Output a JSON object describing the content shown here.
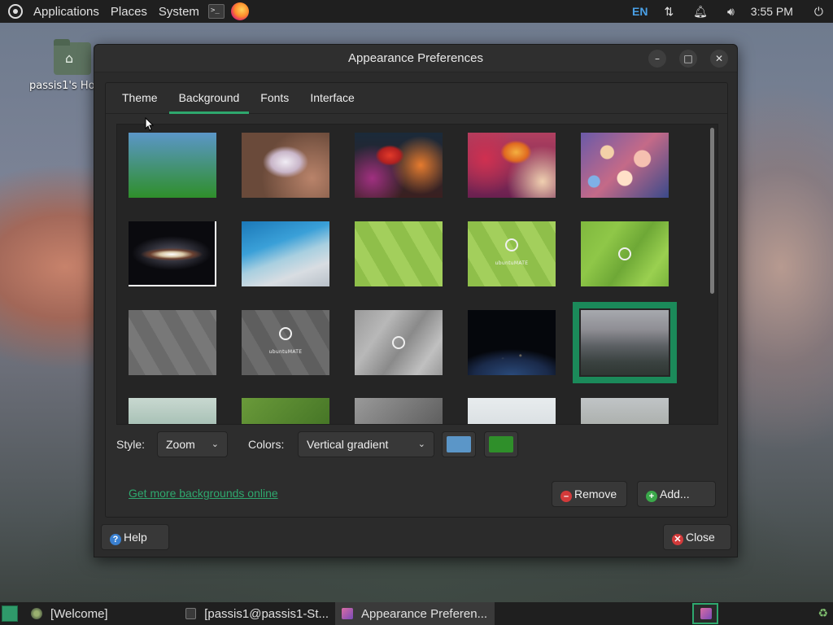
{
  "top_panel": {
    "menus": [
      "Applications",
      "Places",
      "System"
    ],
    "lang": "EN",
    "clock": "3:55 PM"
  },
  "desktop": {
    "home_label": "passis1's Ho"
  },
  "window": {
    "title": "Appearance Preferences",
    "tabs": [
      "Theme",
      "Background",
      "Fonts",
      "Interface"
    ],
    "active_tab": "Background",
    "style_label": "Style:",
    "style_value": "Zoom",
    "colors_label": "Colors:",
    "colors_value": "Vertical gradient",
    "color1": "#5b96c8",
    "color2": "#2f8f2a",
    "get_more_link": "Get more backgrounds online",
    "remove_label": "Remove",
    "add_label": "Add...",
    "help_label": "Help",
    "close_label": "Close",
    "mate_text": "ubuntuMATE"
  },
  "taskbar": {
    "tasks": [
      "[Welcome]",
      "[passis1@passis1-St...",
      "Appearance Preferen..."
    ]
  },
  "colors": {
    "accent": "#2ea86e",
    "selected_outline": "#1b8a5a"
  }
}
